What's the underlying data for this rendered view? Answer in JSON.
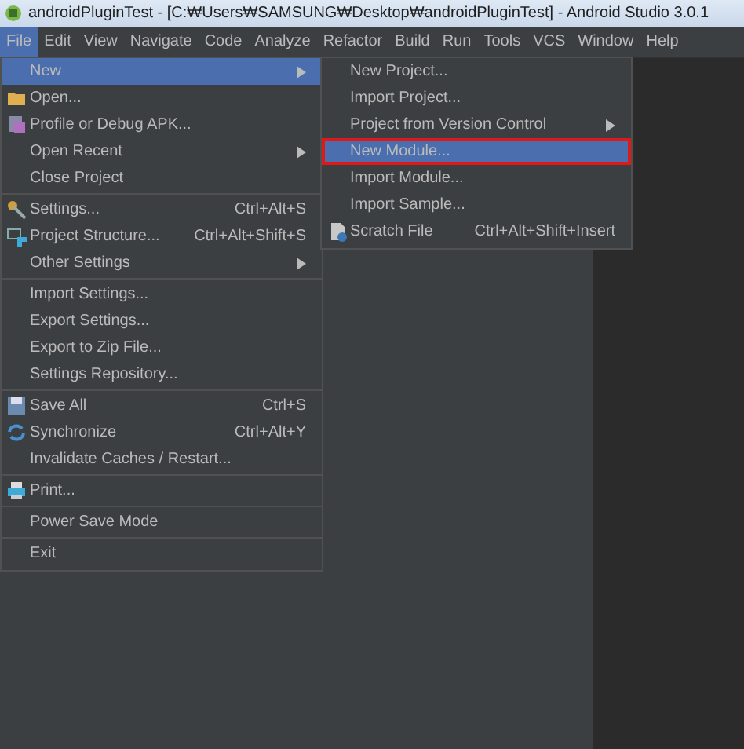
{
  "window": {
    "title": "androidPluginTest - [C:₩Users₩SAMSUNG₩Desktop₩androidPluginTest] - Android Studio 3.0.1"
  },
  "menubar": [
    {
      "label": "File",
      "selected": true
    },
    {
      "label": "Edit",
      "selected": false
    },
    {
      "label": "View",
      "selected": false
    },
    {
      "label": "Navigate",
      "selected": false
    },
    {
      "label": "Code",
      "selected": false
    },
    {
      "label": "Analyze",
      "selected": false
    },
    {
      "label": "Refactor",
      "selected": false
    },
    {
      "label": "Build",
      "selected": false
    },
    {
      "label": "Run",
      "selected": false
    },
    {
      "label": "Tools",
      "selected": false
    },
    {
      "label": "VCS",
      "selected": false
    },
    {
      "label": "Window",
      "selected": false
    },
    {
      "label": "Help",
      "selected": false
    }
  ],
  "file_menu": [
    {
      "kind": "plain",
      "label": "New",
      "submenu": true,
      "selected": true
    },
    {
      "kind": "folder",
      "label": "Open...",
      "submenu": false,
      "selected": false
    },
    {
      "kind": "apk",
      "label": "Profile or Debug APK...",
      "submenu": false,
      "selected": false
    },
    {
      "kind": "plain",
      "label": "Open Recent",
      "submenu": true,
      "selected": false
    },
    {
      "kind": "plain",
      "label": "Close Project",
      "submenu": false,
      "selected": false
    },
    {
      "kind": "separator"
    },
    {
      "kind": "gear",
      "label": "Settings...",
      "shortcut": "Ctrl+Alt+S",
      "submenu": false,
      "selected": false
    },
    {
      "kind": "structure",
      "label": "Project Structure...",
      "shortcut": "Ctrl+Alt+Shift+S",
      "submenu": false,
      "selected": false
    },
    {
      "kind": "plain",
      "label": "Other Settings",
      "submenu": true,
      "selected": false
    },
    {
      "kind": "separator"
    },
    {
      "kind": "plain",
      "label": "Import Settings...",
      "submenu": false,
      "selected": false
    },
    {
      "kind": "plain",
      "label": "Export Settings...",
      "submenu": false,
      "selected": false
    },
    {
      "kind": "plain",
      "label": "Export to Zip File...",
      "submenu": false,
      "selected": false
    },
    {
      "kind": "plain",
      "label": "Settings Repository...",
      "submenu": false,
      "selected": false
    },
    {
      "kind": "separator"
    },
    {
      "kind": "save",
      "label": "Save All",
      "shortcut": "Ctrl+S",
      "submenu": false,
      "selected": false
    },
    {
      "kind": "sync",
      "label": "Synchronize",
      "shortcut": "Ctrl+Alt+Y",
      "submenu": false,
      "selected": false
    },
    {
      "kind": "plain",
      "label": "Invalidate Caches / Restart...",
      "submenu": false,
      "selected": false
    },
    {
      "kind": "separator"
    },
    {
      "kind": "print",
      "label": "Print...",
      "submenu": false,
      "selected": false
    },
    {
      "kind": "separator"
    },
    {
      "kind": "plain",
      "label": "Power Save Mode",
      "submenu": false,
      "selected": false
    },
    {
      "kind": "separator"
    },
    {
      "kind": "plain",
      "label": "Exit",
      "submenu": false,
      "selected": false
    }
  ],
  "new_submenu": [
    {
      "kind": "plain",
      "label": "New Project...",
      "submenu": false,
      "selected": false,
      "outlined": false
    },
    {
      "kind": "plain",
      "label": "Import Project...",
      "submenu": false,
      "selected": false,
      "outlined": false
    },
    {
      "kind": "plain",
      "label": "Project from Version Control",
      "submenu": true,
      "selected": false,
      "outlined": false
    },
    {
      "kind": "plain",
      "label": "New Module...",
      "submenu": false,
      "selected": true,
      "outlined": true
    },
    {
      "kind": "plain",
      "label": "Import Module...",
      "submenu": false,
      "selected": false,
      "outlined": false
    },
    {
      "kind": "plain",
      "label": "Import Sample...",
      "submenu": false,
      "selected": false,
      "outlined": false
    },
    {
      "kind": "scratch",
      "label": "Scratch File",
      "shortcut": "Ctrl+Alt+Shift+Insert",
      "submenu": false,
      "selected": false,
      "outlined": false
    }
  ]
}
